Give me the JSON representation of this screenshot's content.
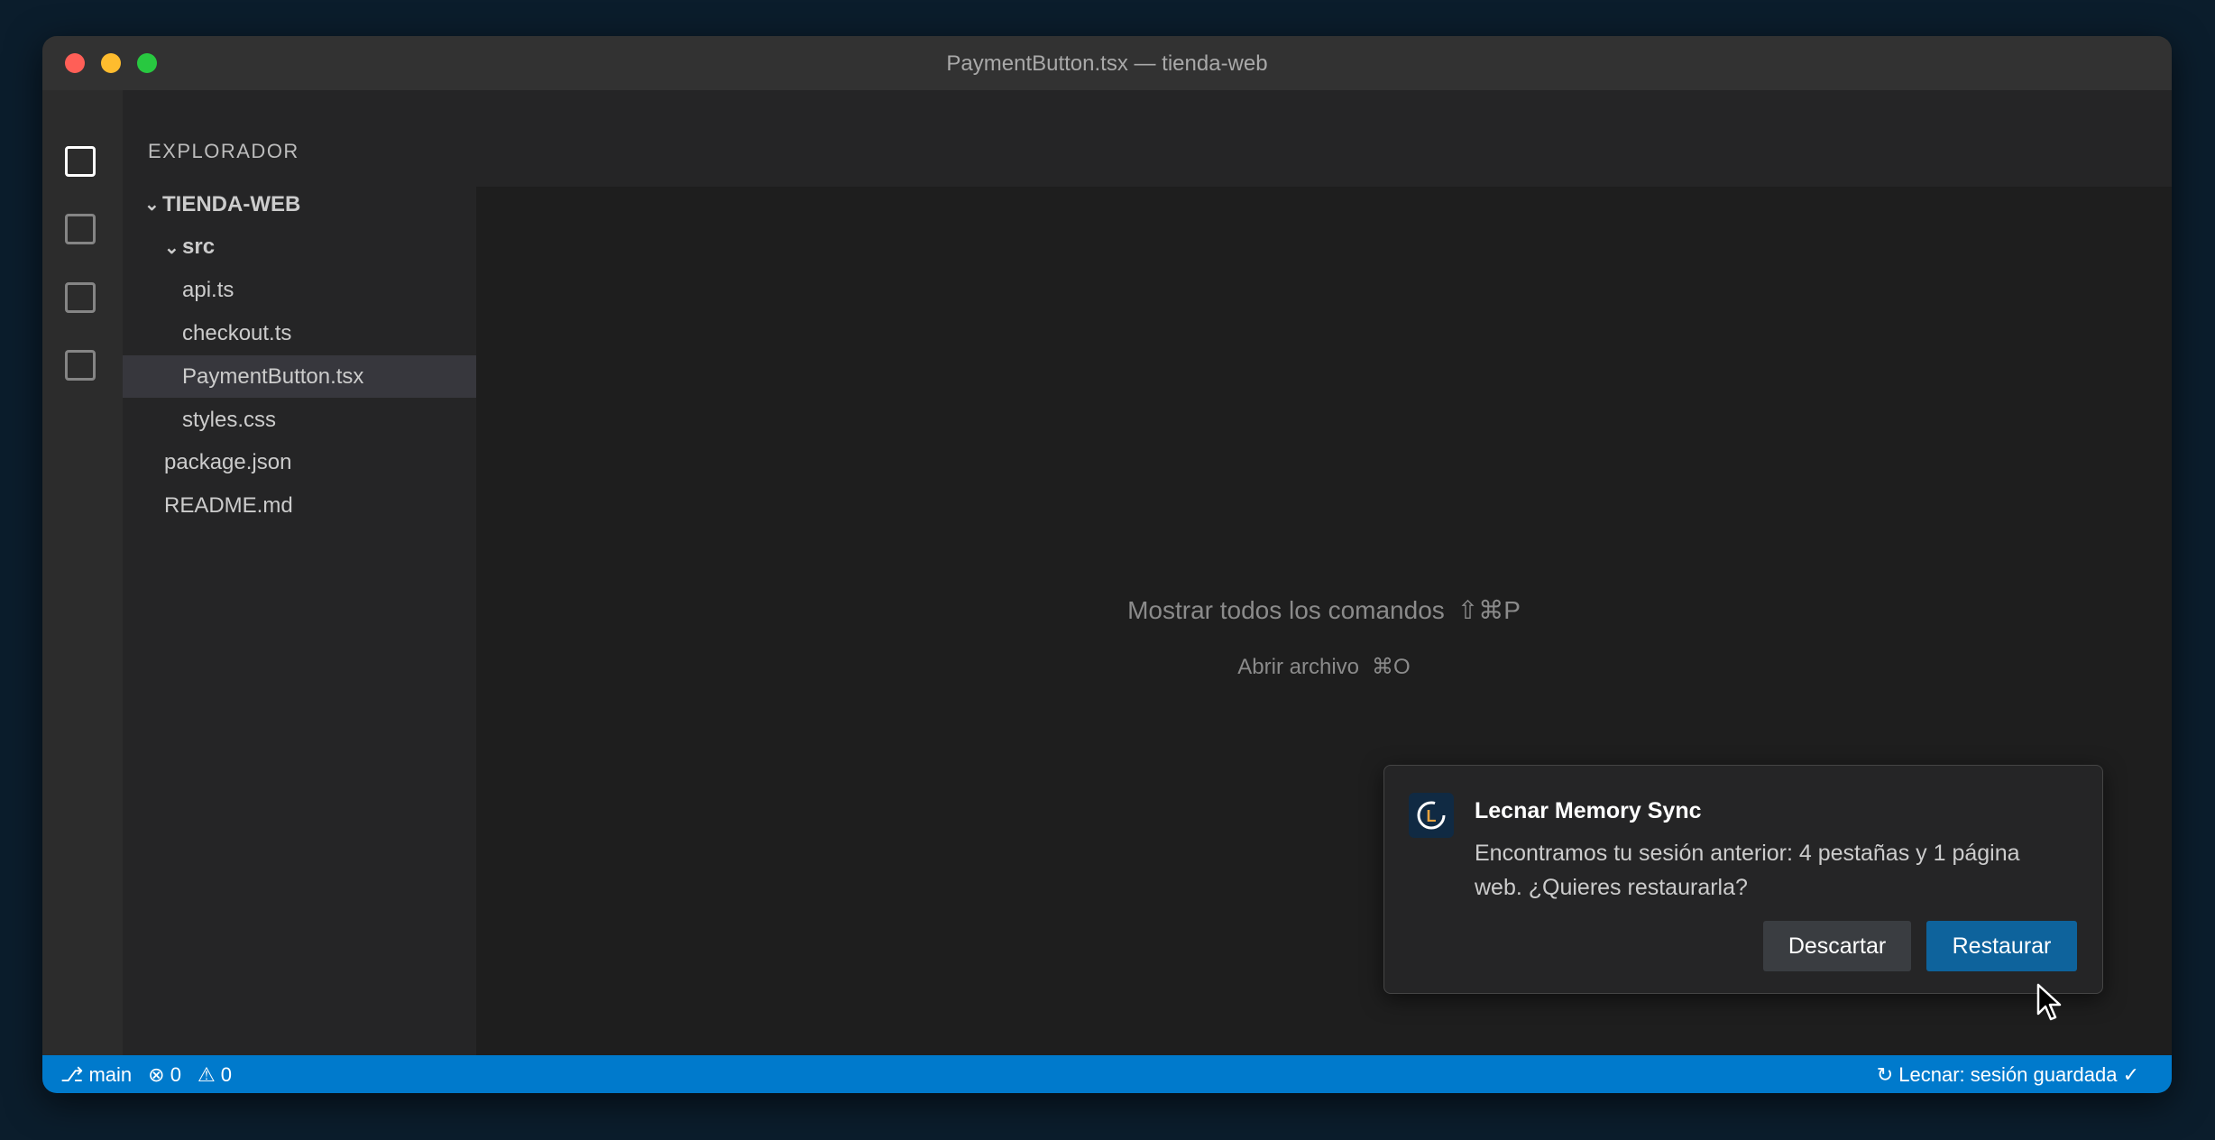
{
  "window": {
    "title": "PaymentButton.tsx — tienda-web"
  },
  "activity_bar": {
    "items": [
      "explorer-icon",
      "search-icon",
      "source-control-icon",
      "extensions-icon"
    ]
  },
  "sidebar": {
    "header": "EXPLORADOR",
    "tree": [
      {
        "label": "TIENDA-WEB",
        "chevron": "⌄",
        "level": 0,
        "bold": true
      },
      {
        "label": "src",
        "chevron": "⌄",
        "level": 1,
        "bold": true
      },
      {
        "label": "api.ts",
        "level": 2
      },
      {
        "label": "checkout.ts",
        "level": 2
      },
      {
        "label": "PaymentButton.tsx",
        "level": 2,
        "selected": true
      },
      {
        "label": "styles.css",
        "level": 2
      },
      {
        "label": "package.json",
        "level": 1
      },
      {
        "label": "README.md",
        "level": 1
      }
    ]
  },
  "editor": {
    "hints": [
      {
        "label": "Mostrar todos los comandos",
        "key": "⇧⌘P"
      },
      {
        "label": "Abrir archivo",
        "key": "⌘O"
      }
    ]
  },
  "statusbar": {
    "branch": "⎇ main",
    "errors": "⊗ 0",
    "warnings": "⚠ 0",
    "right": "↻ Lecnar: sesión guardada ✓"
  },
  "notification": {
    "title": "Lecnar Memory Sync",
    "message": "Encontramos tu sesión anterior: 4 pestañas y 1 página web. ¿Quieres restaurarla?",
    "discard_label": "Descartar",
    "restore_label": "Restaurar",
    "logo_letter": "L",
    "accent": "#e8a33d"
  },
  "colors": {
    "statusbar": "#007acc",
    "primary_button": "#0e639c"
  }
}
